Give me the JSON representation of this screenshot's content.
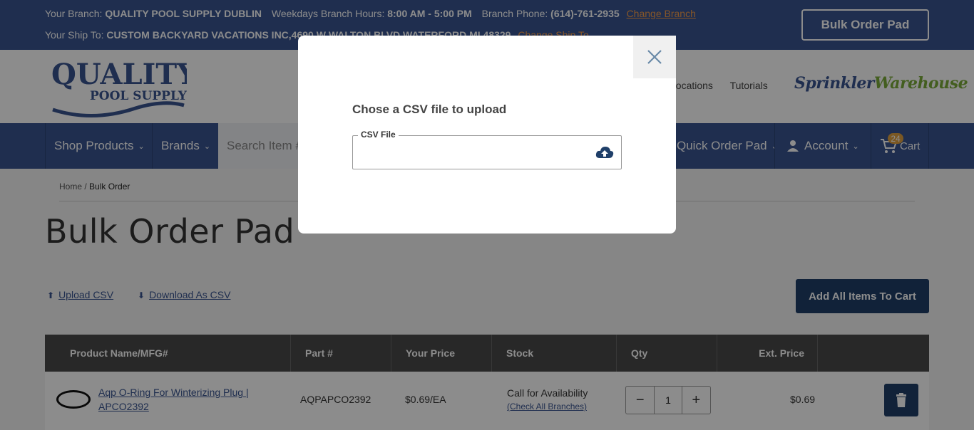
{
  "topbar": {
    "branch_label": "Your Branch:",
    "branch_name": "QUALITY POOL SUPPLY DUBLIN",
    "hours_label": "Weekdays Branch Hours:",
    "hours": "8:00 AM - 5:00 PM",
    "phone_label": "Branch Phone:",
    "phone": "(614)-761-2935",
    "change_branch": "Change Branch",
    "ship_to_label": "Your Ship To:",
    "ship_to": "CUSTOM BACKYARD VACATIONS INC,4690 W WALTON BLVD WATERFORD MI 48329",
    "change_ship_to": "Change Ship To",
    "bulk_order_button": "Bulk Order Pad"
  },
  "header": {
    "logo_line1": "QUALITY",
    "logo_line2": "POOL SUPPLY",
    "links": [
      "Locations",
      "Tutorials"
    ],
    "partner_logo_part1": "Sprinkler",
    "partner_logo_part2": "Warehouse"
  },
  "nav": {
    "shop_products": "Shop Products",
    "brands": "Brands",
    "search_placeholder": "Search Item #",
    "quick_order": "Quick Order Pad",
    "account": "Account",
    "cart": "Cart",
    "cart_count": "24"
  },
  "breadcrumb": {
    "home": "Home",
    "separator": "/",
    "current": "Bulk Order"
  },
  "page": {
    "title": "Bulk Order Pad",
    "upload_csv": "Upload CSV",
    "download_csv": "Download As CSV",
    "add_all": "Add All Items To Cart"
  },
  "table": {
    "headers": [
      "Product Name/MFG#",
      "Part #",
      "Your Price",
      "Stock",
      "Qty",
      "Ext. Price"
    ],
    "rows": [
      {
        "product_name": "Aqp O-Ring For Winterizing Plug | APCO2392",
        "part": "AQPAPCO2392",
        "price": "$0.69/EA",
        "stock": "Call for Availability",
        "check_branches": "(Check All Branches)",
        "qty": "1",
        "ext_price": "$0.69"
      }
    ]
  },
  "modal": {
    "title": "Chose a CSV file to upload",
    "field_label": "CSV File"
  },
  "colors": {
    "brand_blue": "#3a5590",
    "dark_blue": "#1f3f69",
    "accent_orange": "#f39c4a",
    "partner_green": "#7aab3a"
  }
}
